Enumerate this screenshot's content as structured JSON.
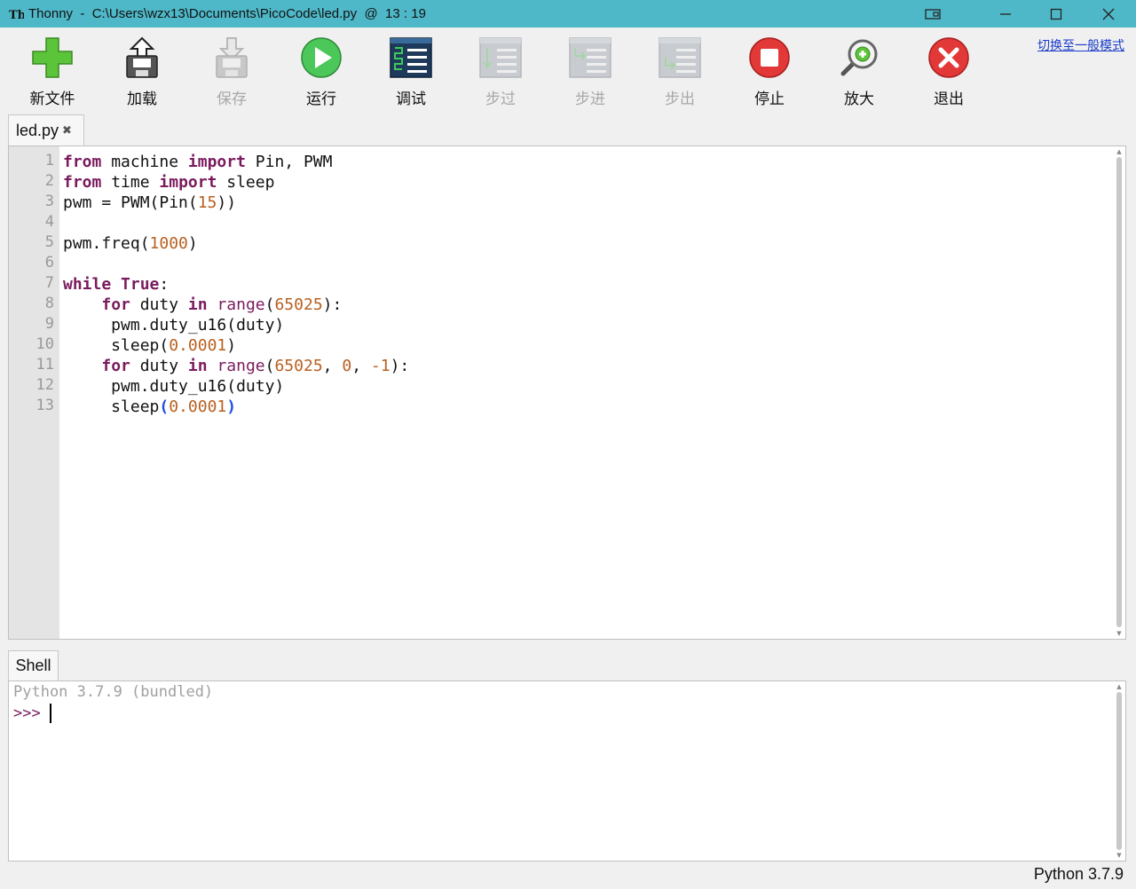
{
  "window": {
    "title": "Thonny  -  C:\\Users\\wzx13\\Documents\\PicoCode\\led.py  @  13 : 19",
    "titlebar_color": "#4fb8c8"
  },
  "toolbar": {
    "items": [
      {
        "label": "新文件",
        "icon": "new-file-icon",
        "enabled": true
      },
      {
        "label": "加载",
        "icon": "load-icon",
        "enabled": true
      },
      {
        "label": "保存",
        "icon": "save-icon",
        "enabled": false
      },
      {
        "label": "运行",
        "icon": "run-icon",
        "enabled": true
      },
      {
        "label": "调试",
        "icon": "debug-icon",
        "enabled": true
      },
      {
        "label": "步过",
        "icon": "step-over-icon",
        "enabled": false
      },
      {
        "label": "步进",
        "icon": "step-into-icon",
        "enabled": false
      },
      {
        "label": "步出",
        "icon": "step-out-icon",
        "enabled": false
      },
      {
        "label": "停止",
        "icon": "stop-icon",
        "enabled": true
      },
      {
        "label": "放大",
        "icon": "zoom-icon",
        "enabled": true
      },
      {
        "label": "退出",
        "icon": "exit-icon",
        "enabled": true
      }
    ],
    "mode_link": "切换至一般模式"
  },
  "editor": {
    "tab_label": "led.py",
    "tab_close": "✖",
    "line_numbers": [
      "1",
      "2",
      "3",
      "4",
      "5",
      "6",
      "7",
      "8",
      "9",
      "10",
      "11",
      "12",
      "13"
    ],
    "code_lines": [
      "from machine import Pin, PWM",
      "from time import sleep",
      "pwm = PWM(Pin(15))",
      "",
      "pwm.freq(1000)",
      "",
      "while True:",
      "    for duty in range(65025):",
      "     pwm.duty_u16(duty)",
      "     sleep(0.0001)",
      "    for duty in range(65025, 0, -1):",
      "     pwm.duty_u16(duty)",
      "     sleep(0.0001)"
    ]
  },
  "shell": {
    "tab_label": "Shell",
    "banner": "Python 3.7.9 (bundled)",
    "prompt": ">>>"
  },
  "status": {
    "text": "Python 3.7.9"
  }
}
